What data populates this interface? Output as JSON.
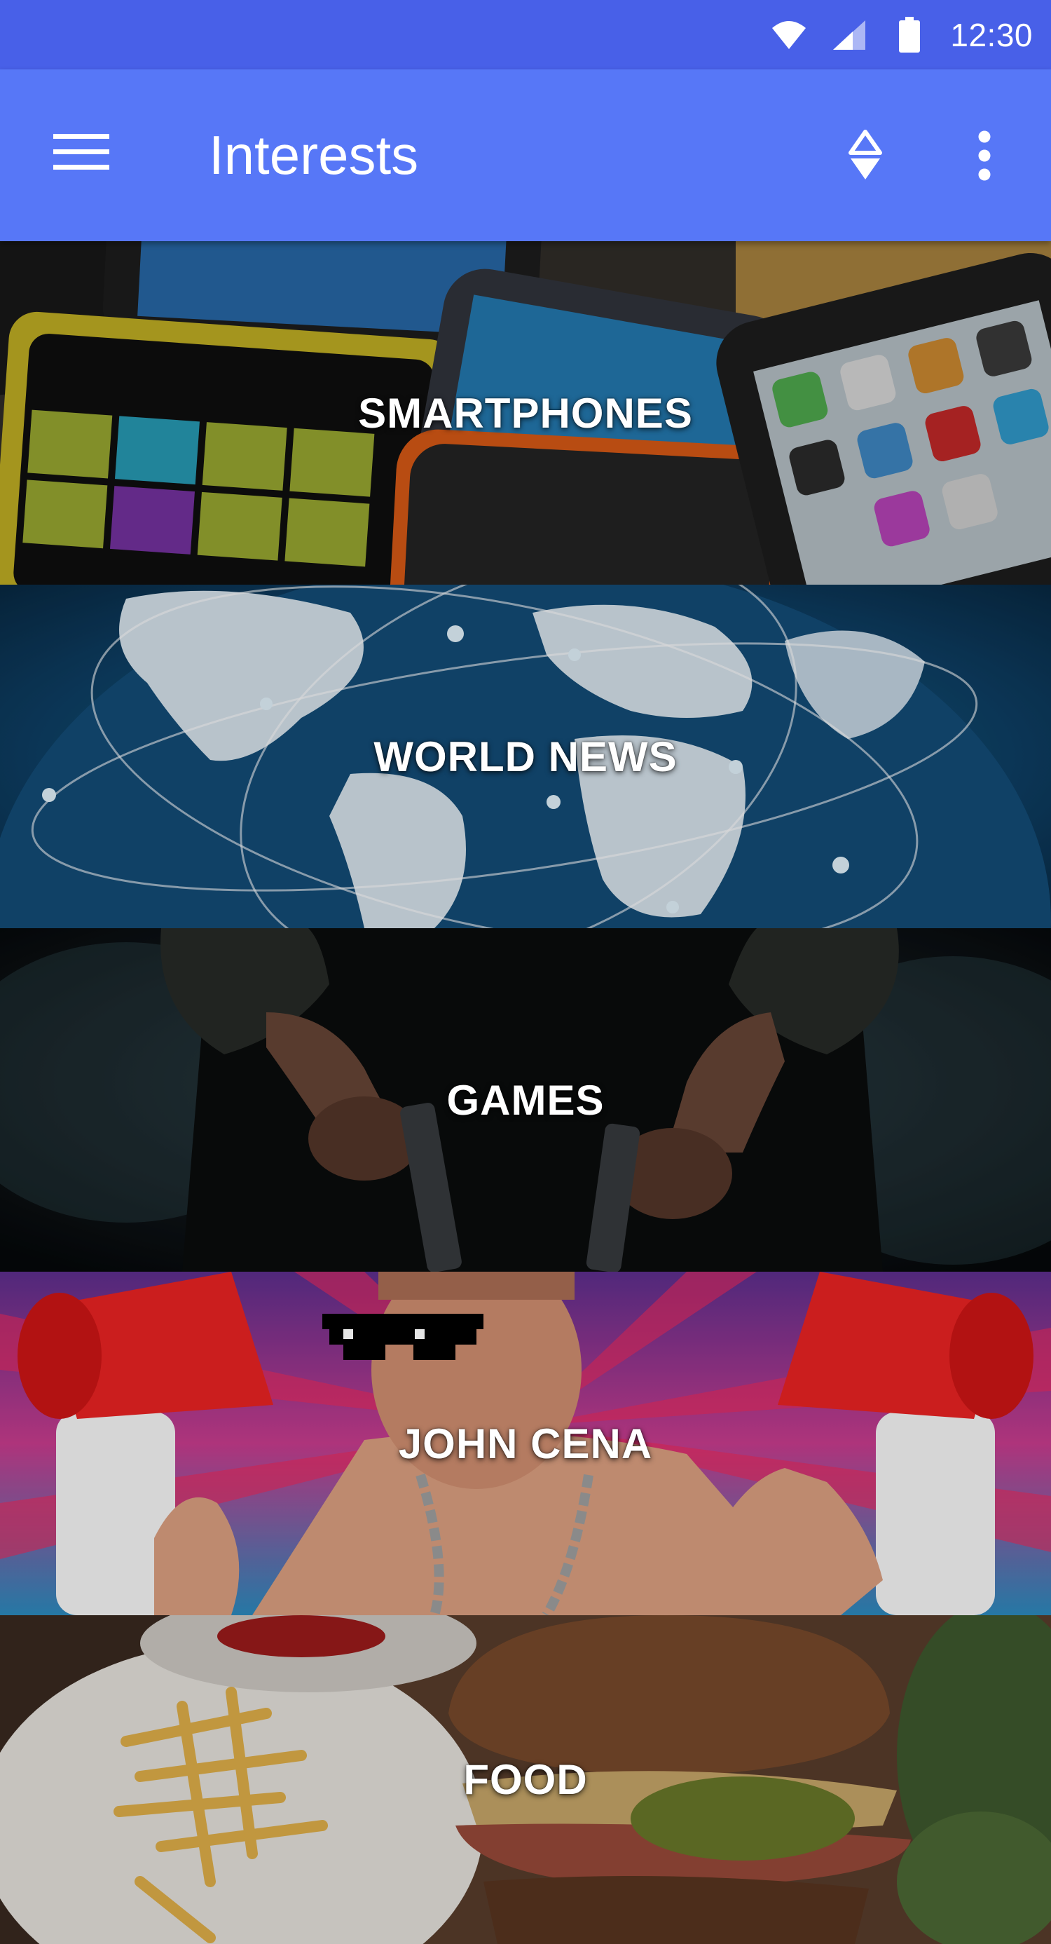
{
  "status_bar": {
    "time": "12:30",
    "icons": [
      "wifi-icon",
      "cell-signal-icon",
      "battery-icon"
    ]
  },
  "app_bar": {
    "title": "Interests",
    "nav_icon": "menu-icon",
    "actions": [
      "sort-icon",
      "more-vert-icon"
    ],
    "background": "#5777f7",
    "status_background": "#4860e8"
  },
  "interests": [
    {
      "label": "SMARTPHONES"
    },
    {
      "label": "WORLD NEWS"
    },
    {
      "label": "GAMES"
    },
    {
      "label": "JOHN CENA"
    },
    {
      "label": "FOOD"
    }
  ]
}
